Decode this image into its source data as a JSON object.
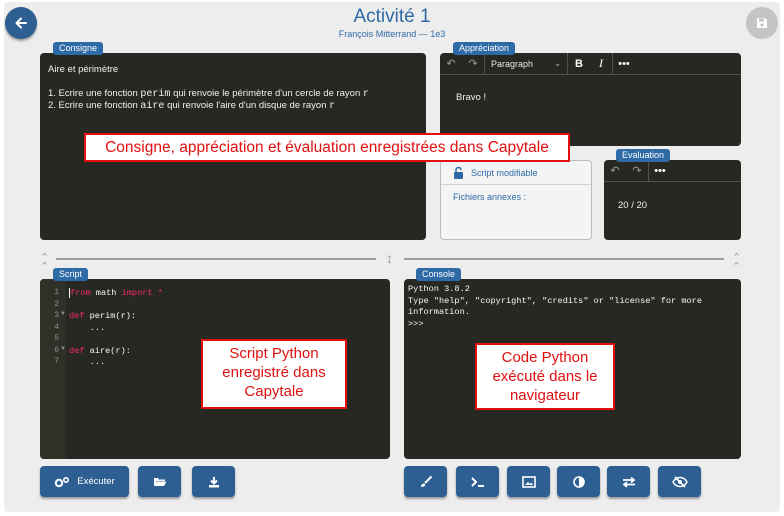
{
  "header": {
    "title": "Activité 1",
    "subtitle": "François Mitterrand — 1e3"
  },
  "consigne": {
    "tag": "Consigne",
    "heading": "Aire et périmètre",
    "line1_prefix": "1. Ecrire une fonction ",
    "line1_code": "perim",
    "line1_mid": " qui renvoie le périmètre d'un cercle de rayon ",
    "line1_arg": "r",
    "line2_prefix": "2. Ecrire une fonction ",
    "line2_code": "aire",
    "line2_mid": " qui renvoie l'aire d'un disque de rayon ",
    "line2_arg": "r"
  },
  "appreciation": {
    "tag": "Appréciation",
    "format_select": "Paragraph",
    "content": "Bravo !"
  },
  "script_panel": {
    "status": "Script modifiable",
    "attachments_label": "Fichiers annexes :"
  },
  "evaluation": {
    "tag": "Evaluation",
    "grade": "20 / 20"
  },
  "script": {
    "tag": "Script",
    "lines": [
      {
        "n": "1",
        "kw1": "from",
        "t1": " math ",
        "kw2": "import",
        "t2": " *"
      },
      {
        "n": "2",
        "text": ""
      },
      {
        "n": "3",
        "kw1": "def",
        "t1": " perim(r):"
      },
      {
        "n": "4",
        "text": "    ..."
      },
      {
        "n": "5",
        "text": ""
      },
      {
        "n": "6",
        "kw1": "def",
        "t1": " aire(r):"
      },
      {
        "n": "7",
        "text": "    ..."
      }
    ]
  },
  "console": {
    "tag": "Console",
    "line1": "Python 3.8.2",
    "line2": "Type \"help\", \"copyright\", \"credits\" or \"license\" for more",
    "line3": "information.",
    "line4": ">>>"
  },
  "callouts": {
    "top": "Consigne, appréciation et évaluation enregistrées dans Capytale",
    "script": "Script Python enregistré dans Capytale",
    "console": "Code Python exécuté dans le navigateur"
  },
  "actions": {
    "run_label": "Exécuter"
  },
  "colors": {
    "accent": "#2e5f93",
    "title": "#2e6aa5",
    "editor_bg": "#272822",
    "callout_red": "#e01010",
    "keyword": "#f92672"
  }
}
